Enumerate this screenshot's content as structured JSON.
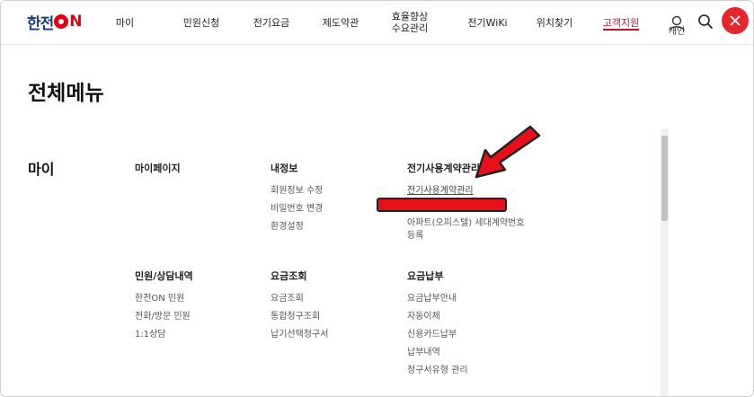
{
  "header": {
    "logo_text": "한전",
    "logo_on": "N",
    "nav": [
      {
        "label": "마이"
      },
      {
        "label": "민원신청"
      },
      {
        "label": "전기요금"
      },
      {
        "label": "제도약관"
      },
      {
        "label": "효율향상\n수요관리"
      },
      {
        "label": "전기WiKi"
      },
      {
        "label": "위치찾기"
      },
      {
        "label": "고객지원"
      }
    ],
    "user_label": "개인"
  },
  "page_title": "전체메뉴",
  "section": {
    "title": "마이",
    "groups": [
      {
        "title": "마이페이지",
        "items": []
      },
      {
        "title": "내정보",
        "items": [
          "회원정보 수정",
          "비밀번호 변경",
          "환경설정"
        ]
      },
      {
        "title": "전기사용계약관리",
        "items": [
          "전기사용계약관리",
          "아파트(오피스텔) 세대계약번호 등록"
        ]
      },
      {
        "title": "민원/상담내역",
        "items": [
          "한전ON 민원",
          "전화/방문 민원",
          "1:1상담"
        ]
      },
      {
        "title": "요금조회",
        "items": [
          "요금조회",
          "통합청구조회",
          "납기선택청구서"
        ]
      },
      {
        "title": "요금납부",
        "items": [
          "요금납부안내",
          "자동이체",
          "신용카드납부",
          "납부내역",
          "청구서유형 관리"
        ]
      }
    ]
  },
  "colors": {
    "brand_blue": "#1c3d7a",
    "brand_red": "#e60012",
    "active": "#c8102e"
  }
}
